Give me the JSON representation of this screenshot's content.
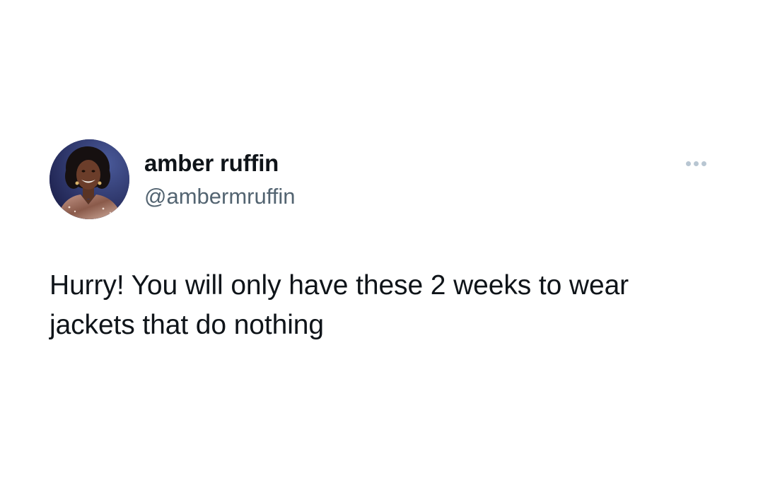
{
  "author": {
    "display_name": "amber ruffin",
    "handle": "@ambermruffin",
    "avatar_icon": "profile-photo"
  },
  "more_icon": "more-horizontal-icon",
  "tweet": {
    "text_lines": [
      "Hurry! You will only have these 2 weeks to wear",
      "jackets that do nothing"
    ]
  },
  "colors": {
    "background": "#ffffff",
    "name": "#0f1419",
    "handle": "#536471",
    "more_dots": "#b8c6d2"
  }
}
